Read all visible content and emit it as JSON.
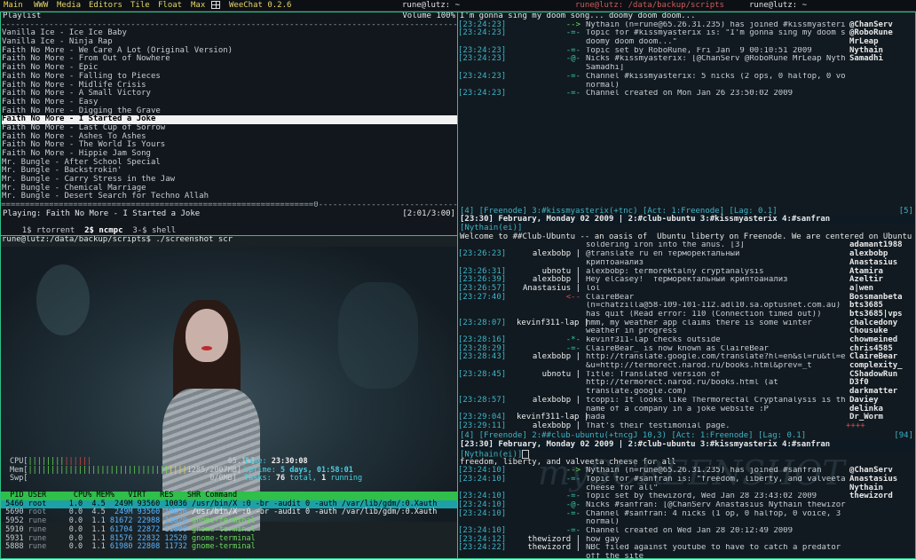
{
  "topbar": {
    "workspaces": [
      "Main",
      "WWW",
      "Media",
      "Editors",
      "Tile",
      "Float",
      "Max"
    ],
    "app": "WeeChat 0.2.6",
    "title_left": "rune@lutz: ~",
    "title_mid": "rune@lutz: /data/backup/scripts",
    "title_right": "rune@lutz: ~"
  },
  "ncmpc": {
    "header_title": "Playlist",
    "volume": "Volume 100%",
    "songs": [
      "Vanilla Ice - Ice Ice Baby",
      "Vanilla Ice - Ninja Rap",
      "Faith No More - We Care A Lot (Original Version)",
      "Faith No More - From Out of Nowhere",
      "Faith No More - Epic",
      "Faith No More - Falling to Pieces",
      "Faith No More - Midlife Crisis",
      "Faith No More - A Small Victory",
      "Faith No More - Easy",
      "Faith No More - Digging the Grave",
      "Faith No More - I Started a Joke",
      "Faith No More - Last Cup of Sorrow",
      "Faith No More - Ashes To Ashes",
      "Faith No More - The World Is Yours",
      "Faith No More - Hippie Jam Song",
      "Mr. Bungle - After School Special",
      "Mr. Bungle - Backstrokin'",
      "Mr. Bungle - Carry Stress in the Jaw",
      "Mr. Bungle - Chemical Marriage",
      "Mr. Bungle - Desert Search for Techno Allah"
    ],
    "selected_index": 10,
    "progress_bar": "=================================================================0--------------------------------------------------------------",
    "playing_label": "Playing: Faith No More - I Started a Joke",
    "time": "[2:01/3:00]",
    "tabs": [
      "1$ rtorrent",
      "2$ ncmpc",
      "3-$ shell"
    ]
  },
  "shell": {
    "prompt": "rune@lutz:/data/backup/scripts$ ./screenshot scr"
  },
  "htop": {
    "cpu_label": "CPU[",
    "cpu_bar": "||||||||",
    "cpu_value": "65.1%]",
    "mem_label": "Mem[",
    "mem_bar": "|||||||||||||||||||||||||||||||",
    "mem_value": "1285/2007MB]",
    "swp_label": "Swp[",
    "swp_value": "0/0MB]",
    "time_label": "Time:",
    "time_value": "23:30:08",
    "uptime_label": "Uptime:",
    "uptime_days": "5 days,",
    "uptime_time": "01:58:01",
    "tasks_label": "Tasks:",
    "tasks_total": "76",
    "tasks_total_label": "total,",
    "tasks_running": "1",
    "tasks_running_label": "running",
    "header": "  PID USER      CPU% MEM%   VIRT   RES   SHR Command",
    "rows": [
      {
        "pid": " 5466",
        "user": "root   ",
        "cpu": " 1.0",
        "mem": " 4.5",
        "virt": " 249M",
        "res": "93560",
        "shr": "10036",
        "cmd": "/usr/bin/X :0 -br -audit 0 -auth /var/lib/gdm/:0.Xauth"
      },
      {
        "pid": " 5690",
        "user": "root   ",
        "cpu": " 0.0",
        "mem": " 4.5",
        "virt": " 249M",
        "res": "93560",
        "shr": "10036",
        "cmd": "/usr/bin/X :0 -br -audit 0 -auth /var/lib/gdm/:0.Xauth"
      },
      {
        "pid": " 5952",
        "user": "rune   ",
        "cpu": " 0.0",
        "mem": " 1.1",
        "virt": "81672",
        "res": "22988",
        "shr": "12620",
        "cmd": "gnome-terminal"
      },
      {
        "pid": " 5910",
        "user": "rune   ",
        "cpu": " 0.0",
        "mem": " 1.1",
        "virt": "61704",
        "res": "22872",
        "shr": "11800",
        "cmd": "gnome-terminal"
      },
      {
        "pid": " 5931",
        "user": "rune   ",
        "cpu": " 0.0",
        "mem": " 1.1",
        "virt": "81576",
        "res": "22832",
        "shr": "12520",
        "cmd": "gnome-terminal"
      },
      {
        "pid": " 5888",
        "user": "rune   ",
        "cpu": " 0.0",
        "mem": " 1.1",
        "virt": "61980",
        "res": "22808",
        "shr": "11732",
        "cmd": "gnome-terminal"
      }
    ]
  },
  "weechat": {
    "top_msg": "I'm gonna sing my doom song... doomy doom doom...",
    "ch1_lines": [
      {
        "ts": "[23:24:23]",
        "nick": "-->",
        "msg": "Nythain (n=rune@65.26.31.235) has joined #kissmyasterix"
      },
      {
        "ts": "[23:24:23]",
        "nick": "-=-",
        "msg": "Topic for #kissmyasterix is: \"I'm gonna sing my doom song..."
      },
      {
        "ts": "",
        "nick": "",
        "msg": "doomy doom doom...\""
      },
      {
        "ts": "[23:24:23]",
        "nick": "-=-",
        "msg": "Topic set by RoboRune, Fri Jan  9 00:10:51 2009"
      },
      {
        "ts": "[23:24:23]",
        "nick": "-@-",
        "msg": "Nicks #kissmyasterix: [@ChanServ @RoboRune MrLeap Nythain"
      },
      {
        "ts": "",
        "nick": "",
        "msg": "Samadhi]"
      },
      {
        "ts": "[23:24:23]",
        "nick": "-=-",
        "msg": "Channel #kissmyasterix: 5 nicks (2 ops, 0 halfop, 0 voice, 3"
      },
      {
        "ts": "",
        "nick": "",
        "msg": "normal)"
      },
      {
        "ts": "[23:24:23]",
        "nick": "-=-",
        "msg": "Channel created on Mon Jan 26 23:50:02 2009"
      }
    ],
    "ch1_nicks": [
      "@ChanServ",
      "@RoboRune",
      "MrLeap",
      "Nythain",
      "Samadhi"
    ],
    "status1": "[4] [Freenode] 3:#kissmyasterix(+tnc) [Act: 1:Freenode] [Lag: 0.1]",
    "status1_right": "[5]",
    "bar1": "[23:30] February, Monday 02 2009 | 2:#club-ubuntu 3:#kissmyasterix 4:#sanfran",
    "input1": "[Nythain(ei)]",
    "topic2": "Welcome to ##Club-Ubuntu -- an oasis of  Ubuntu liberty on Freenode. We are centered on Ubuntu bu++",
    "ch2_lines": [
      {
        "ts": "",
        "nick": "",
        "msg": "soldering iron into the anus. [3]"
      },
      {
        "ts": "[23:26:23]",
        "nick": "alexbobp |",
        "msg": "@translate ru en терморектальный"
      },
      {
        "ts": "",
        "nick": "",
        "msg": "криптоанализ"
      },
      {
        "ts": "[23:26:31]",
        "nick": "ubnotu |",
        "msg": "alexbobp: termorektalny cryptanalysis"
      },
      {
        "ts": "[23:26:39]",
        "nick": "alexbobp |",
        "msg": "Hey elcasey!  терморектальный криптоанализ"
      },
      {
        "ts": "[23:26:57]",
        "nick": "Anastasius |",
        "msg": "lol"
      },
      {
        "ts": "[23:27:40]",
        "nick": "<--",
        "msg": "ClaireBear"
      },
      {
        "ts": "",
        "nick": "",
        "msg": "(n=chatzilla@58-109-101-112.adl10.sa.optusnet.com.au)"
      },
      {
        "ts": "",
        "nick": "",
        "msg": "has quit (Read error: 110 (Connection timed out))"
      },
      {
        "ts": "[23:28:07]",
        "nick": "kevinf311-lap |",
        "msg": "hmm, my weather app claims there is some winter"
      },
      {
        "ts": "",
        "nick": "",
        "msg": "weather in progress"
      },
      {
        "ts": "[23:28:16]",
        "nick": "-*-",
        "msg": "kevinf311-lap checks outside"
      },
      {
        "ts": "[23:28:29]",
        "nick": "-=-",
        "msg": "ClaireBear_ is now known as ClaireBear"
      },
      {
        "ts": "[23:28:43]",
        "nick": "alexbobp |",
        "msg": "http://translate.google.com/translate?hl=en&sl=ru&tl=en"
      },
      {
        "ts": "",
        "nick": "",
        "msg": "&u=http://termorect.narod.ru/books.html&prev=_t"
      },
      {
        "ts": "[23:28:45]",
        "nick": "ubnotu |",
        "msg": "Title: Translated version of"
      },
      {
        "ts": "",
        "nick": "",
        "msg": "http://termorect.narod.ru/books.html (at"
      },
      {
        "ts": "",
        "nick": "",
        "msg": "translate.google.com)"
      },
      {
        "ts": "[23:28:57]",
        "nick": "alexbobp |",
        "msg": "tcoppi: It looks like Thermorectal Cryptanalysis is the"
      },
      {
        "ts": "",
        "nick": "",
        "msg": "name of a company in a joke website :P"
      },
      {
        "ts": "[23:29:04]",
        "nick": "kevinf311-lap |",
        "msg": "nada"
      },
      {
        "ts": "[23:29:11]",
        "nick": "alexbobp |",
        "msg": "That's their testimonial page."
      }
    ],
    "ch2_nicks": [
      "adamant1988",
      "alexbobp",
      "Anastasius",
      "Atamira",
      "Azeltir",
      "a|wen",
      "Bossmanbeta",
      "bts3685",
      "bts3685|vps",
      "chalcedony",
      "Chousuke",
      "chowmeined",
      "chris4585",
      "ClaireBear",
      "complexity_",
      "CShadowRun",
      "D3f0",
      "darkmatter",
      "Daviey",
      "delinka",
      "Dr_Worm",
      "++++"
    ],
    "status2": "[4] [Freenode] 2:##club-ubuntu(+tncgJ 10,3) [Act: 1:Freenode] [Lag: 0.1]",
    "status2_right": "[94]",
    "bar2": "[23:30] February, Monday 02 2009 | 2:#club-ubuntu 3:#kissmyasterix 4:#sanfran",
    "input2": "[Nythain(ei)]",
    "topic3": "freedom, liberty, and valveeta cheese for all",
    "ch3_lines": [
      {
        "ts": "[23:24:10]",
        "nick": "-->",
        "msg": "Nythain (n=rune@65.26.31.235) has joined #sanfran"
      },
      {
        "ts": "[23:24:10]",
        "nick": "-=-",
        "msg": "Topic for #sanfran is: \"freedom, liberty, and valveeta"
      },
      {
        "ts": "",
        "nick": "",
        "msg": "cheese for all\""
      },
      {
        "ts": "[23:24:10]",
        "nick": "-=-",
        "msg": "Topic set by thewizord, Wed Jan 28 23:43:02 2009"
      },
      {
        "ts": "[23:24:10]",
        "nick": "-@-",
        "msg": "Nicks #sanfran: [@ChanServ Anastasius Nythain thewizord]"
      },
      {
        "ts": "[23:24:10]",
        "nick": "-=-",
        "msg": "Channel #sanfran: 4 nicks (1 op, 0 halfop, 0 voice, 3"
      },
      {
        "ts": "",
        "nick": "",
        "msg": "normal)"
      },
      {
        "ts": "[23:24:10]",
        "nick": "-=-",
        "msg": "Channel created on Wed Jan 28 20:12:49 2009"
      },
      {
        "ts": "[23:24:12]",
        "nick": "thewizord |",
        "msg": "how gay"
      },
      {
        "ts": "[23:24:22]",
        "nick": "thewizord |",
        "msg": "NBC filed against youtube to have to catch a predator taken"
      },
      {
        "ts": "",
        "nick": "",
        "msg": "off the site"
      }
    ],
    "ch3_nicks": [
      "@ChanServ",
      "Anastasius",
      "Nythain",
      "thewizord"
    ]
  }
}
